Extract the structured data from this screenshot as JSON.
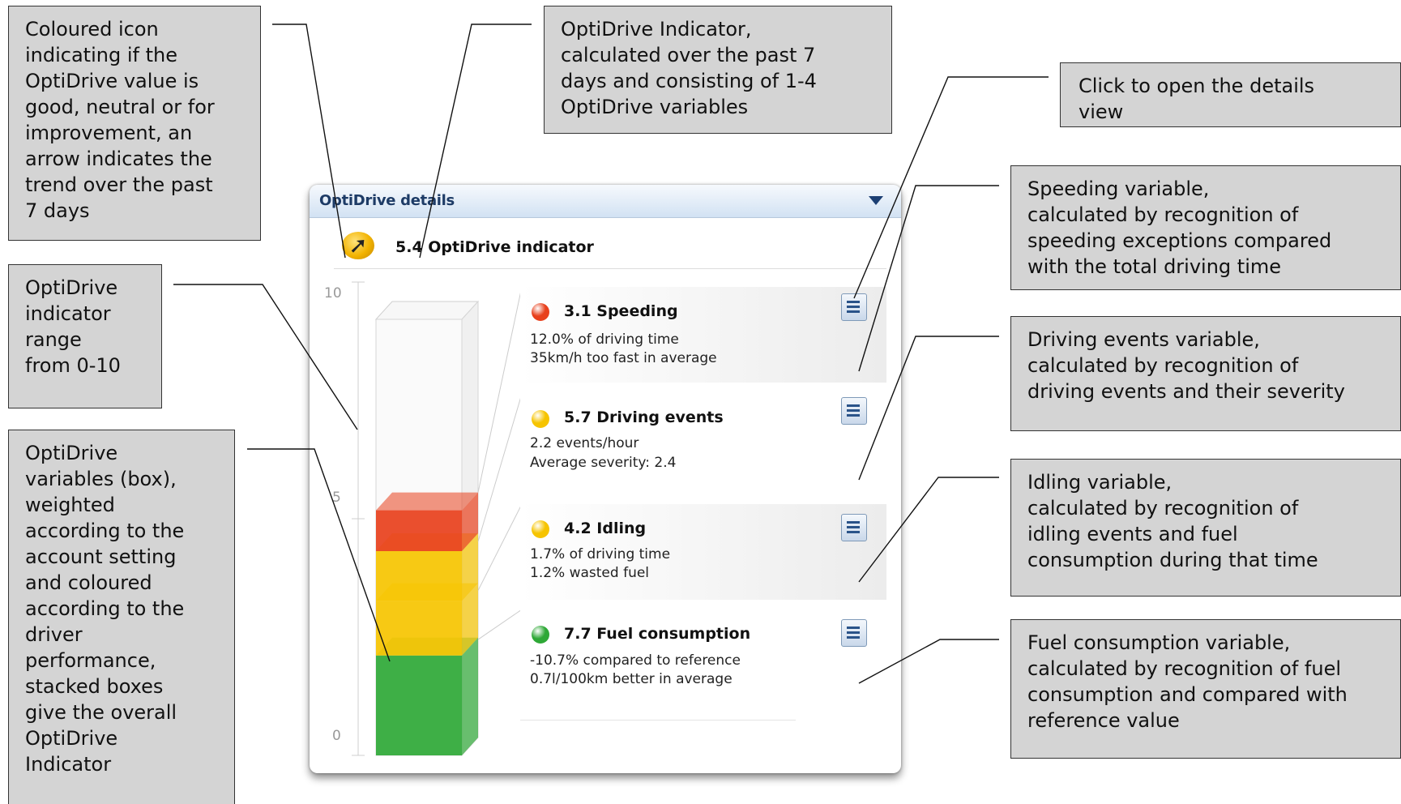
{
  "callouts": {
    "icon": "Coloured icon\nindicating if the\nOptiDrive value is\ngood, neutral or for\nimprovement, an\narrow indicates the\ntrend over the past\n7 days",
    "indicator": "OptiDrive Indicator,\ncalculated over the past 7\ndays and consisting of 1-4\nOptiDrive variables",
    "details": "Click to open the details\nview",
    "range": "OptiDrive\nindicator\nrange\nfrom 0-10",
    "box": "OptiDrive\nvariables (box),\nweighted\naccording to the\naccount setting\nand coloured\naccording to the\ndriver\nperformance,\nstacked boxes\ngive the overall\nOptiDrive\nIndicator",
    "speeding": "Speeding variable,\ncalculated by recognition of\nspeeding exceptions compared\nwith the total driving time",
    "events": "Driving events variable,\ncalculated by recognition of\ndriving events and their severity",
    "idling": "Idling variable,\ncalculated by recognition of\nidling events and fuel\nconsumption during that time",
    "fuel": "Fuel consumption variable,\ncalculated by recognition of fuel\nconsumption and compared with\nreference value"
  },
  "panel": {
    "title": "OptiDrive details",
    "menu_icon": "dropdown-triangle-icon",
    "indicator_value": 5.4,
    "indicator_text": "5.4 OptiDrive indicator",
    "indicator_icon": "trend-arrow-icon",
    "indicator_color": "#f2b300"
  },
  "axis": {
    "min": 0,
    "max": 10,
    "labels": [
      "10",
      "5",
      "0"
    ]
  },
  "variables": [
    {
      "title": "3.1 Speeding",
      "status": "red",
      "color": "#e8401c",
      "lines": [
        "12.0% of driving time",
        "35km/h too fast in average"
      ],
      "details_icon": "document-list-icon"
    },
    {
      "title": "5.7 Driving events",
      "status": "yellow",
      "color": "#f6c400",
      "lines": [
        "2.2 events/hour",
        "Average severity: 2.4"
      ],
      "details_icon": "document-list-icon"
    },
    {
      "title": "4.2 Idling",
      "status": "yellow",
      "color": "#f6c400",
      "lines": [
        "1.7% of driving time",
        "1.2% wasted fuel"
      ],
      "details_icon": "document-list-icon"
    },
    {
      "title": "7.7 Fuel consumption",
      "status": "green",
      "color": "#2ea836",
      "lines": [
        "-10.7% compared to reference",
        "0.7l/100km better in average"
      ],
      "details_icon": "document-list-icon"
    }
  ],
  "stack": [
    {
      "name": "Fuel consumption",
      "color": "#2ea836"
    },
    {
      "name": "Idling",
      "color": "#f6c400"
    },
    {
      "name": "Driving events",
      "color": "#f6c400"
    },
    {
      "name": "Speeding",
      "color": "#e8401c"
    }
  ]
}
